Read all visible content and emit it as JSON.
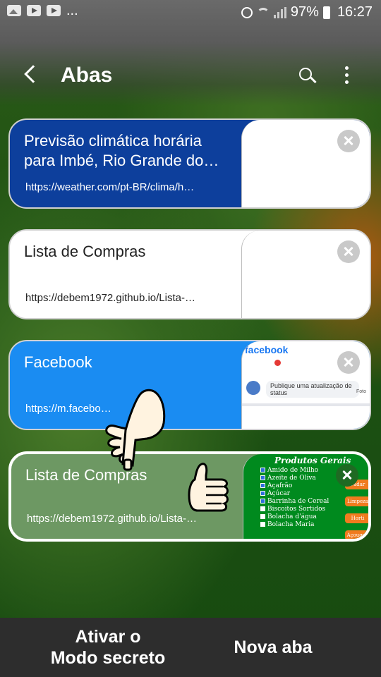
{
  "status_bar": {
    "battery": "97%",
    "time": "16:27",
    "notification_overflow": "..."
  },
  "header": {
    "title": "Abas"
  },
  "tabs": [
    {
      "title": "Previsão climática horária para Imbé, Rio Grande do…",
      "url": "https://weather.com/pt-BR/clima/h…"
    },
    {
      "title": "Lista de Compras",
      "url": "https://debem1972.github.io/Lista-…"
    },
    {
      "title": "Facebook",
      "url": "https://m.facebo…",
      "thumbnail": {
        "brand": "facebook",
        "post_prompt": "Publique uma atualização de status",
        "photo_label": "Foto"
      }
    },
    {
      "title": "Lista de Compras",
      "url": "https://debem1972.github.io/Lista-…",
      "thumbnail": {
        "heading": "Produtos Gerais",
        "items": [
          {
            "label": "Amido de Milho",
            "checked": true
          },
          {
            "label": "Azeite de Oliva",
            "checked": true
          },
          {
            "label": "Açafrão",
            "checked": true
          },
          {
            "label": "Açúcar",
            "checked": true
          },
          {
            "label": "Barrinha de Cereal",
            "checked": true
          },
          {
            "label": "Biscoitos Sortidos",
            "checked": false
          },
          {
            "label": "Bolacha d'água",
            "checked": false
          },
          {
            "label": "Bolacha Maria",
            "checked": false
          }
        ],
        "buttons": [
          "Padar",
          "Limpeza",
          "Horti",
          "Açougue"
        ]
      }
    }
  ],
  "bottom_bar": {
    "secret_mode_label": "Ativar o\nModo secreto",
    "new_tab_label": "Nova aba"
  }
}
